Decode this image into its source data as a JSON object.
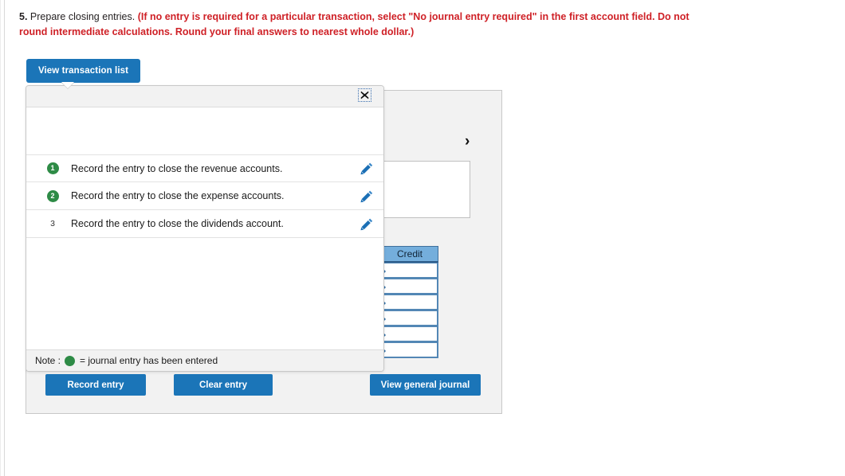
{
  "prompt": {
    "number": "5.",
    "plain": " Prepare closing entries. ",
    "red": "(If no entry is required for a particular transaction, select \"No journal entry required\" in the first account field. Do not round intermediate calculations. Round your final answers to nearest whole dollar.)"
  },
  "tab": {
    "label": "View transaction list"
  },
  "popup": {
    "close_label": "×",
    "items": [
      {
        "badge": "1",
        "entered": true,
        "label": "Record the entry to close the revenue accounts."
      },
      {
        "badge": "2",
        "entered": true,
        "label": "Record the entry to close the expense accounts."
      },
      {
        "badge": "3",
        "entered": false,
        "label": "Record the entry to close the dividends account."
      }
    ],
    "note_prefix": "Note :",
    "note_suffix": "= journal entry has been entered"
  },
  "journal": {
    "chevron": "›",
    "headers": {
      "debit": "",
      "credit": "Credit"
    },
    "row_count": 6
  },
  "actions": {
    "record": "Record entry",
    "clear": "Clear entry",
    "view_general_journal": "View general journal"
  },
  "colors": {
    "primary_blue": "#1b75b8",
    "table_header_blue": "#74aedc",
    "badge_green": "#2e8b46",
    "prompt_red": "#cf2127",
    "panel_gray": "#f2f2f2"
  }
}
